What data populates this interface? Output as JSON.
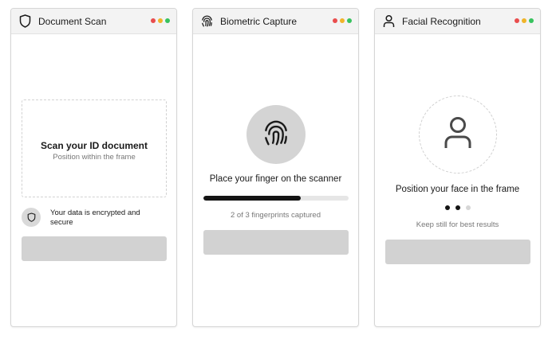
{
  "window_dots": [
    "#e94d4d",
    "#f0b429",
    "#37c25e"
  ],
  "document_scan": {
    "title": "Document Scan",
    "icon": "shield-icon",
    "frame_title": "Scan your ID document",
    "frame_subtitle": "Position within the frame",
    "security_note": "Your data is encrypted and secure",
    "button_label": ""
  },
  "biometric_capture": {
    "title": "Biometric Capture",
    "icon": "fingerprint-icon",
    "instruction": "Place your finger on the scanner",
    "progress": 0.67,
    "status": "2 of 3 fingerprints captured",
    "button_label": ""
  },
  "facial_recognition": {
    "title": "Facial Recognition",
    "icon": "user-icon",
    "instruction": "Position your face in the frame",
    "steps_total": 3,
    "steps_active": 2,
    "hint": "Keep still for best results",
    "button_label": ""
  }
}
